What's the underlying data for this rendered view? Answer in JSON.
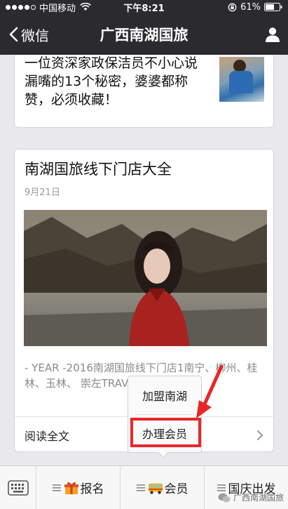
{
  "status_bar": {
    "carrier": "中国移动",
    "time": "下午8:21",
    "battery": "61%"
  },
  "nav": {
    "back_label": "微信",
    "title": "广西南湖国旅"
  },
  "previous_article": {
    "title": "一位资深家政保洁员不小心说漏嘴的13个秘密，婆婆都称赞，必须收藏！"
  },
  "article": {
    "title": "南湖国旅线下门店大全",
    "date": "9月21日",
    "excerpt": "- YEAR -2016南湖国旅线下门店1南宁、柳州、桂林、玉林、      崇左TRAVELER 旅行家",
    "read_more": "阅读全文"
  },
  "popup_menu": {
    "items": [
      "加盟南湖",
      "办理会员"
    ],
    "highlighted": "办理会员"
  },
  "bottom_menu": {
    "tabs": [
      {
        "label": "报名",
        "icon": "gift-icon"
      },
      {
        "label": "会员",
        "icon": "bus-icon"
      },
      {
        "label": "国庆出发",
        "icon": ""
      }
    ]
  },
  "watermark": "广西南湖国旅",
  "colors": {
    "bar_dark": "#2b2b2f",
    "highlight_red": "#e8262a",
    "background": "#e9e9ed"
  }
}
